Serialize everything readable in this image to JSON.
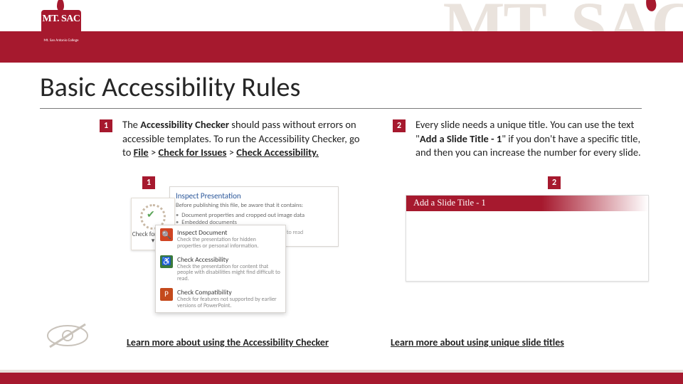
{
  "header": {
    "watermark": "MT. SAC",
    "logo_main": "MT. SAC",
    "logo_sub": "Mt. San Antonio College"
  },
  "title": "Basic Accessibility Rules",
  "col1": {
    "num": "1",
    "html": "The <b>Accessibility Checker</b> should pass without errors on accessible templates. To run the Accessibility Checker, go to <span class='u'>File</span> > <span class='u'>Check for Issues</span> > <span class='u'>Check Accessibility.</span>",
    "subnum": "1",
    "check_btn": "Check for Issues ▾",
    "panel_title": "Inspect Presentation",
    "panel_intro": "Before publishing this file, be aware that it contains:",
    "panel_b1": "Document properties and cropped out image data",
    "panel_b2": "Embedded documents",
    "panel_warn": "Content that people with disabilities are unable to read",
    "opt1_t": "Inspect Document",
    "opt1_d": "Check the presentation for hidden properties or personal information.",
    "opt2_t": "Check Accessibility",
    "opt2_d": "Check the presentation for content that people with disabilities might find difficult to read.",
    "opt3_t": "Check Compatibility",
    "opt3_d": "Check for features not supported by earlier versions of PowerPoint.",
    "link": "Learn more about using the Accessibility Checker"
  },
  "col2": {
    "num": "2",
    "html": "Every slide needs a unique title. You can use the text \"<b>Add a Slide Title - 1</b>\" if you don't have a specific title, and then you can increase the number for every slide.",
    "subnum": "2",
    "slide_title": "Add a Slide Title - 1",
    "link": "Learn more about using unique slide titles"
  }
}
